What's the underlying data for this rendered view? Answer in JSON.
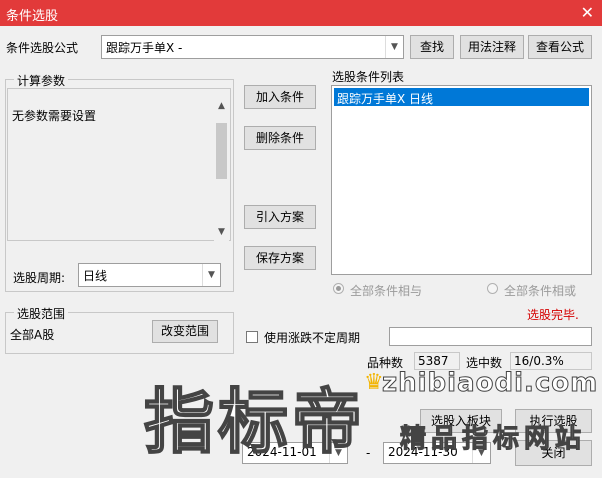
{
  "window": {
    "title": "条件选股"
  },
  "formula": {
    "label": "条件选股公式",
    "value": "跟踪万手单X  -"
  },
  "buttons": {
    "find": "查找",
    "usage": "用法注释",
    "view_formula": "查看公式",
    "add_condition": "加入条件",
    "delete_condition": "删除条件",
    "import_plan": "引入方案",
    "save_plan": "保存方案",
    "change_range": "改变范围",
    "select_into_block": "选股入板块",
    "run_select": "执行选股",
    "close": "关闭"
  },
  "params": {
    "group_title": "计算参数",
    "message": "无参数需要设置",
    "period_label": "选股周期:",
    "period_value": "日线"
  },
  "conditions": {
    "title": "选股条件列表",
    "items": [
      "跟踪万手单X  日线"
    ]
  },
  "logic": {
    "option_and": "全部条件相与",
    "option_or": "全部条件相或"
  },
  "status": {
    "done": "选股完毕."
  },
  "range": {
    "group_title": "选股范围",
    "value": "全部A股"
  },
  "options": {
    "use_variable_period": "使用涨跌不定周期"
  },
  "stats": {
    "total_label": "品种数",
    "total_value": "5387",
    "selected_label": "选中数",
    "selected_value": "16/0.3%"
  },
  "dates": {
    "start": "2024-11-01",
    "separator": "-",
    "end": "2024-11-30"
  },
  "watermark": {
    "big": "指标帝",
    "url": "zhibiaodi.com",
    "sub": "精品指标网站"
  }
}
